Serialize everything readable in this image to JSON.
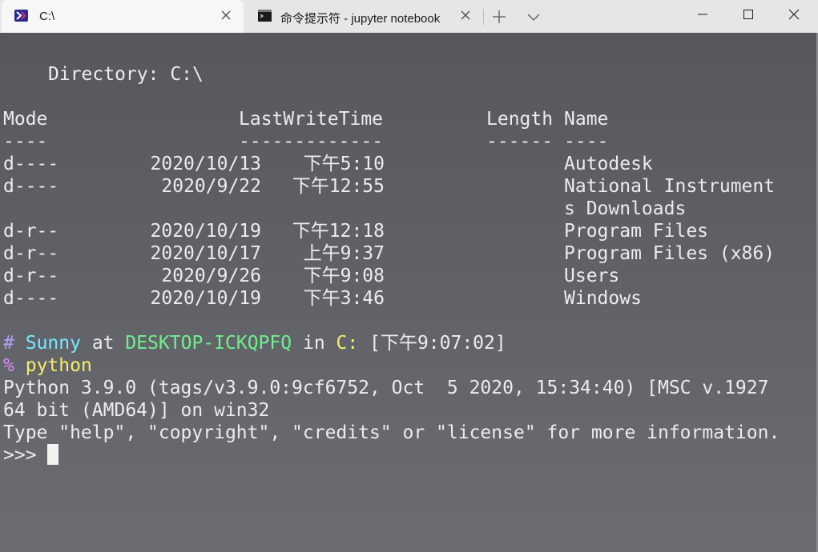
{
  "tabs": [
    {
      "label": "C:\\",
      "active": true,
      "icon": "powershell-icon"
    },
    {
      "label": "命令提示符 - jupyter  notebook",
      "active": false,
      "icon": "cmd-icon"
    }
  ],
  "terminal": {
    "directory_line": "Directory: C:\\",
    "headers": {
      "mode": "Mode",
      "time": "LastWriteTime",
      "length": "Length",
      "name": "Name"
    },
    "dividers": {
      "mode": "----",
      "time": "-------------",
      "length": "------",
      "name": "----"
    },
    "rows": [
      {
        "mode": "d----",
        "date": "2020/10/13",
        "time": "下午5:10",
        "name": "Autodesk"
      },
      {
        "mode": "d----",
        "date": "2020/9/22",
        "time": "下午12:55",
        "name": "National Instrument\ns Downloads"
      },
      {
        "mode": "d-r--",
        "date": "2020/10/19",
        "time": "下午12:18",
        "name": "Program Files"
      },
      {
        "mode": "d-r--",
        "date": "2020/10/17",
        "time": "上午9:37",
        "name": "Program Files (x86)"
      },
      {
        "mode": "d-r--",
        "date": "2020/9/26",
        "time": "下午9:08",
        "name": "Users"
      },
      {
        "mode": "d----",
        "date": "2020/10/19",
        "time": "下午3:46",
        "name": "Windows"
      }
    ],
    "prompt": {
      "hash": "#",
      "user": "Sunny",
      "at": "at",
      "host": "DESKTOP-ICKQPFQ",
      "in": "in",
      "drive": "C:",
      "timestamp": "[下午9:07:02]",
      "symbol": "%",
      "command": "python"
    },
    "output": [
      "Python 3.9.0 (tags/v3.9.0:9cf6752, Oct  5 2020, 15:34:40) [MSC v.1927",
      "64 bit (AMD64)] on win32",
      "Type \"help\", \"copyright\", \"credits\" or \"license\" for more information."
    ],
    "repl_prompt": ">>> "
  },
  "colors": {
    "background": "#56585d",
    "prompt_hash": "#b49cf5",
    "user": "#7ae6ff",
    "host": "#6ff08c",
    "drive": "#f5ec6a",
    "command": "#f5ec6a"
  }
}
